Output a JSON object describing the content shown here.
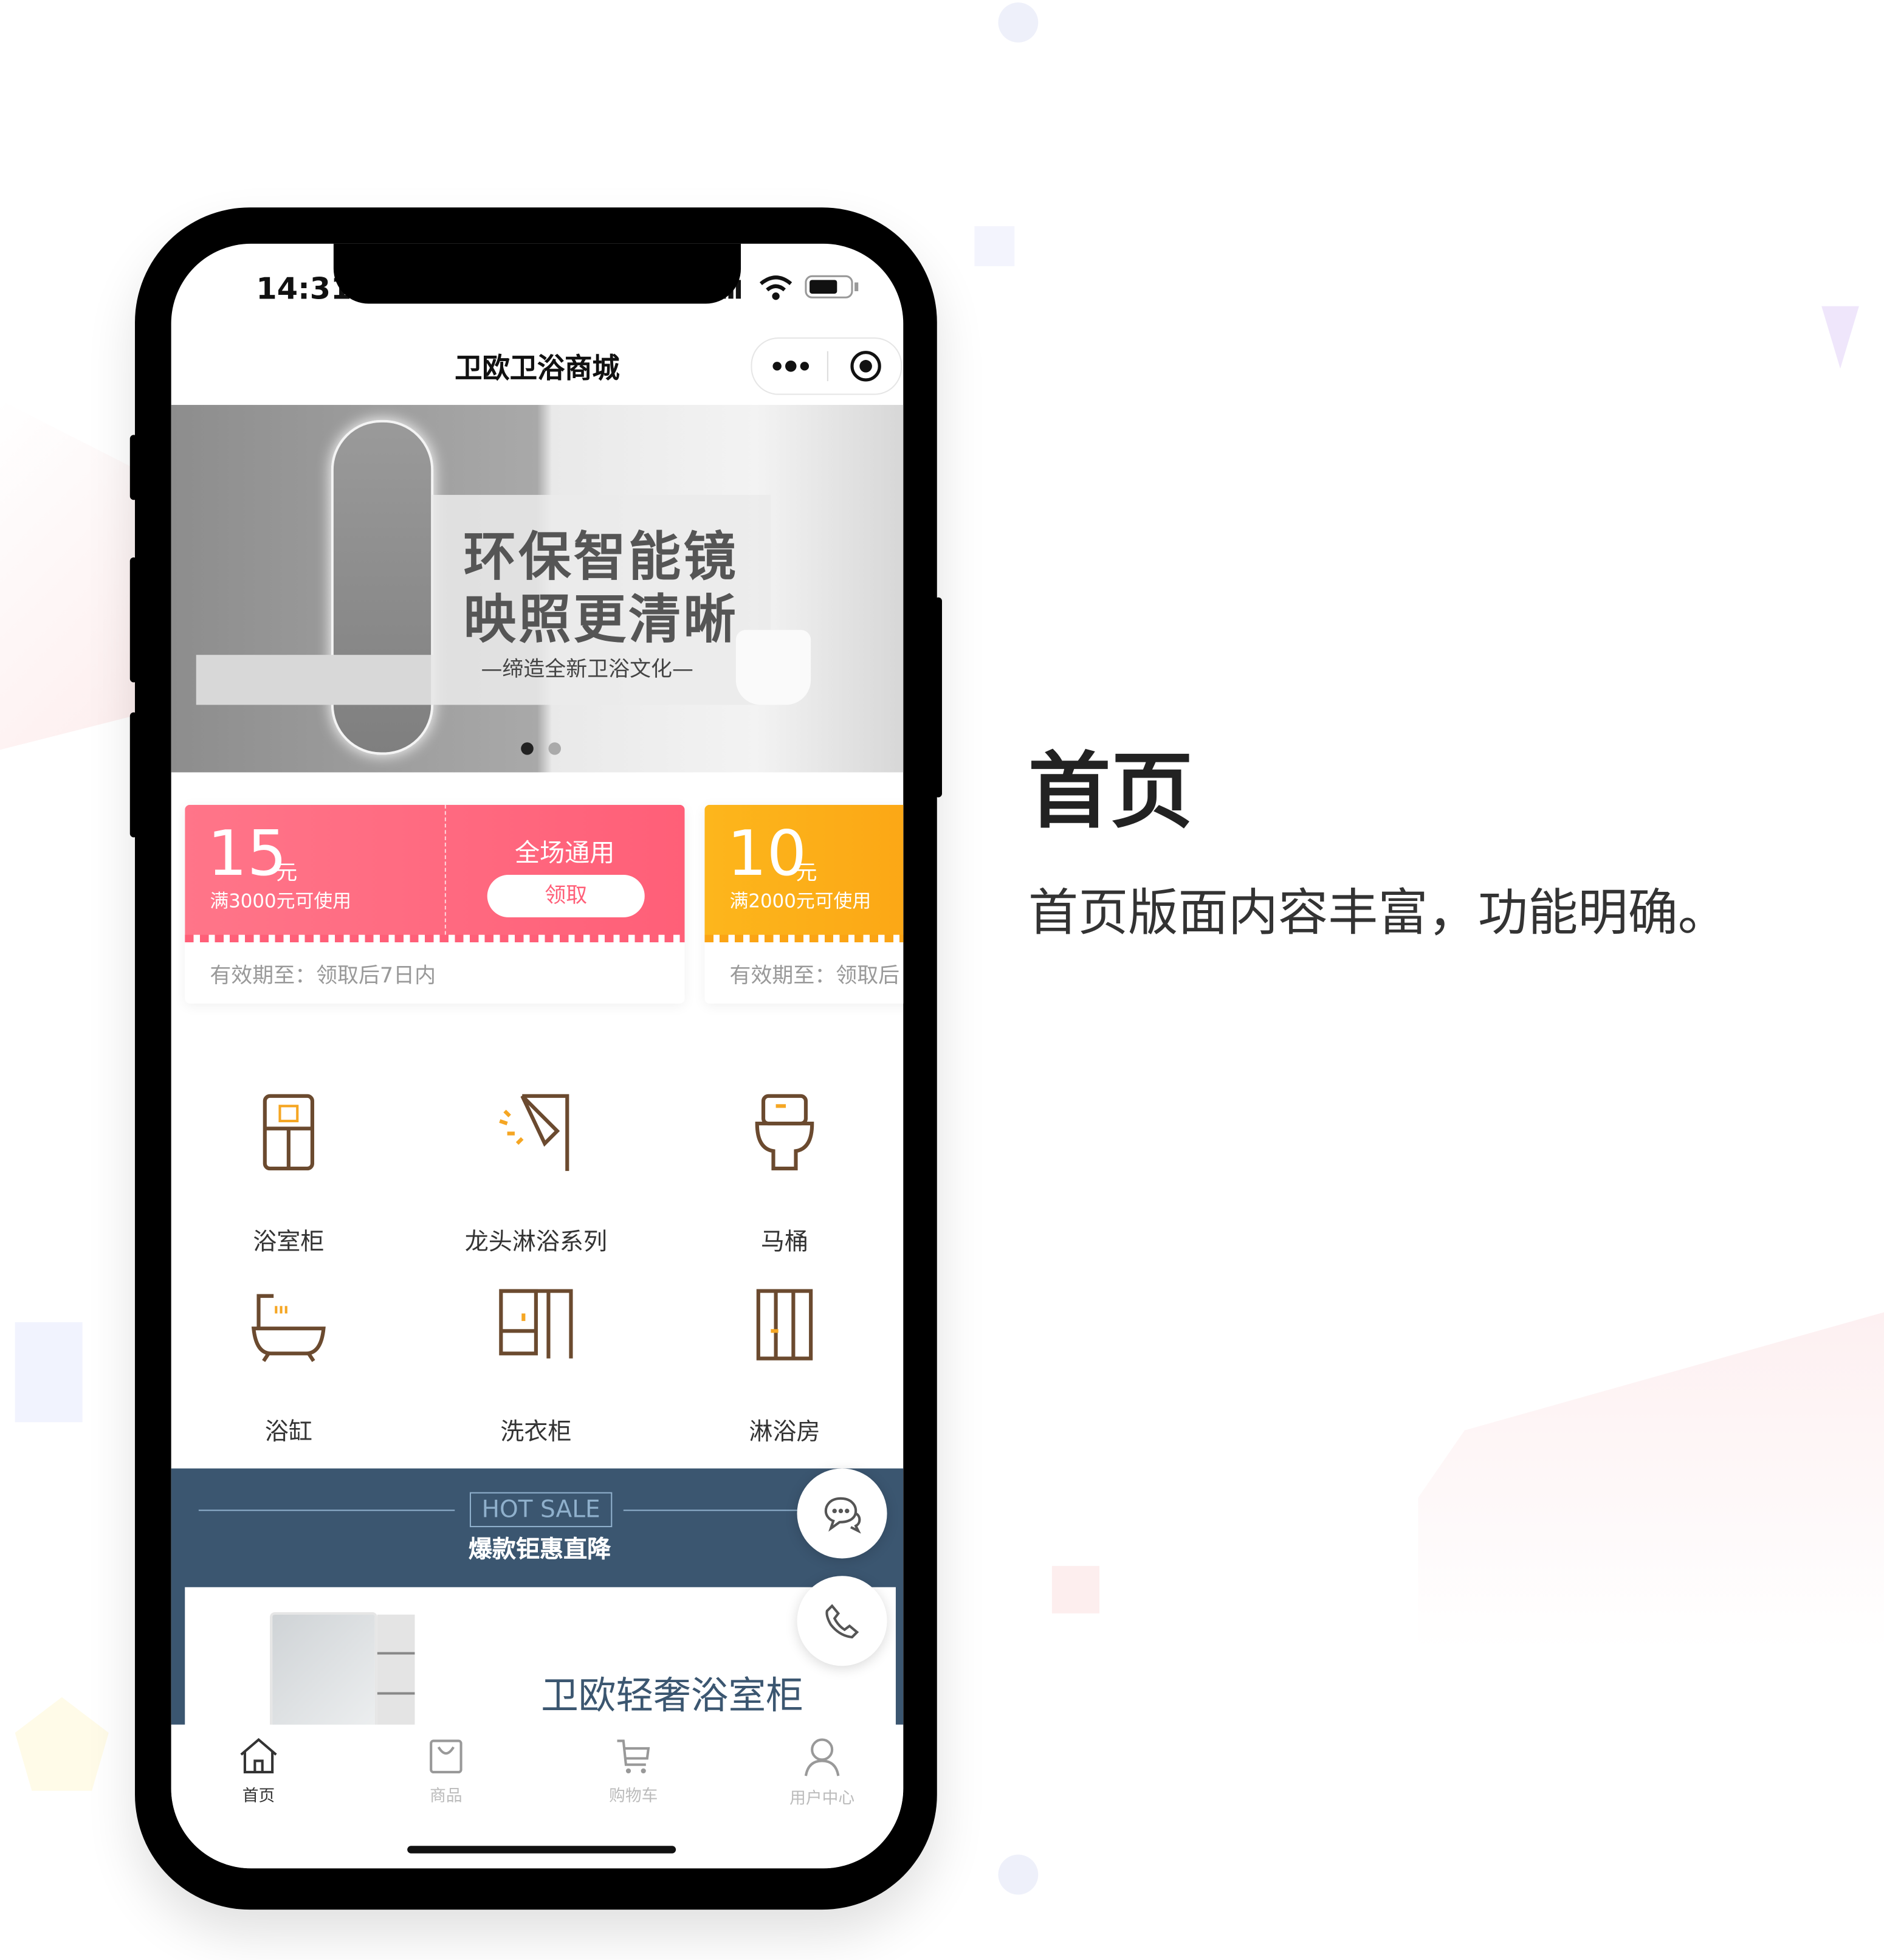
{
  "status_bar": {
    "time": "14:31"
  },
  "nav": {
    "title": "卫欧卫浴商城",
    "more_icon": "more-dots-icon",
    "close_icon": "target-circle-icon"
  },
  "banner": {
    "headline_1": "环保智能镜",
    "headline_2": "映照更清晰",
    "tagline": "—缔造全新卫浴文化—",
    "slide_count": 2,
    "active_slide": 1
  },
  "coupons": [
    {
      "amount": "15",
      "unit": "元",
      "condition": "满3000元可使用",
      "scope": "全场通用",
      "claim_label": "领取",
      "validity": "有效期至：领取后7日内",
      "color": "#ff6b81"
    },
    {
      "amount": "10",
      "unit": "元",
      "condition": "满2000元可使用",
      "validity": "有效期至：领取后",
      "color": "#fbae17"
    }
  ],
  "categories": [
    {
      "label": "浴室柜",
      "icon": "bathroom-cabinet-icon"
    },
    {
      "label": "龙头淋浴系列",
      "icon": "shower-head-icon"
    },
    {
      "label": "马桶",
      "icon": "toilet-icon"
    },
    {
      "label": "浴缸",
      "icon": "bathtub-icon"
    },
    {
      "label": "洗衣柜",
      "icon": "laundry-cabinet-icon"
    },
    {
      "label": "淋浴房",
      "icon": "shower-room-icon"
    }
  ],
  "hot_sale": {
    "badge": "HOT SALE",
    "subtitle": "爆款钜惠直降",
    "bg_color": "#3b5670"
  },
  "product": {
    "title": "卫欧轻奢浴室柜"
  },
  "floating": {
    "chat_icon": "chat-bubble-icon",
    "phone_icon": "phone-icon"
  },
  "tabbar": [
    {
      "label": "首页",
      "icon": "home-icon",
      "active": true
    },
    {
      "label": "商品",
      "icon": "shopping-bag-icon",
      "active": false
    },
    {
      "label": "购物车",
      "icon": "cart-icon",
      "active": false
    },
    {
      "label": "用户中心",
      "icon": "user-icon",
      "active": false
    }
  ],
  "promo": {
    "heading": "首页",
    "description": "首页版面内容丰富，功能明确。"
  }
}
